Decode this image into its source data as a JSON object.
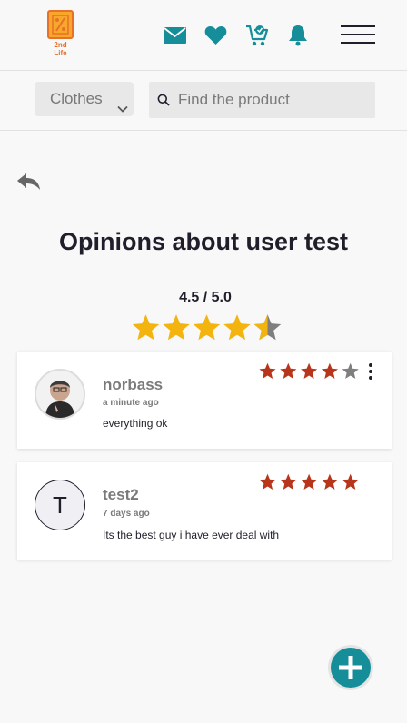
{
  "colors": {
    "accent": "#168e99",
    "star_gold": "#f4b410",
    "star_red": "#b8351b",
    "star_empty": "#7f7f7f"
  },
  "header": {
    "logo_text": [
      "2nd",
      "Life"
    ],
    "icons": [
      "mail-icon",
      "heart-icon",
      "cart-icon",
      "bell-icon",
      "hamburger-menu-icon"
    ]
  },
  "search": {
    "category": "Clothes",
    "placeholder": "Find the product"
  },
  "page": {
    "title": "Opinions about user test",
    "score": "4.5 / 5.0",
    "rating": 4.5
  },
  "reviews": [
    {
      "name": "norbass",
      "time": "a minute ago",
      "text": "everything ok",
      "rating": 4,
      "avatar": "photo"
    },
    {
      "name": "test2",
      "time": "7 days ago",
      "text": "Its the best guy i have ever deal with",
      "rating": 5,
      "avatar": "T"
    }
  ]
}
